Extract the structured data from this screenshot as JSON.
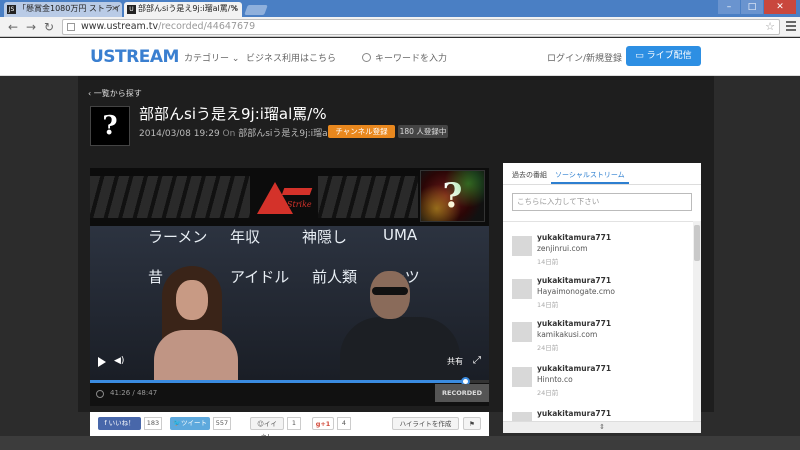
{
  "browser": {
    "tabs": [
      {
        "label": "「懸賞金1080万円 ストライ",
        "favicon": "JS"
      },
      {
        "label": "部部んsiう是え9j:i瑠al罵/%",
        "favicon": "U"
      }
    ],
    "url_host": "www.ustream.tv",
    "url_path": "/recorded/44647679",
    "window_buttons": [
      "–",
      "□",
      "✕"
    ]
  },
  "header": {
    "logo": "USTREAM",
    "nav": [
      "カテゴリー ⌄",
      "ビジネス利用はこちら"
    ],
    "search_placeholder": "キーワードを入力",
    "login": "ログイン/新規登録",
    "live_button": "ライブ配信"
  },
  "channel": {
    "back_link": "‹ 一覧から探す",
    "avatar_glyph": "?",
    "title": "部部んsiう是え9j:i瑠al罵/%",
    "date": "2014/03/08 19:29",
    "on": "On",
    "channel_name": "部部んsiう是え9j:i瑠al罵/%",
    "subscribe": "チャンネル登録",
    "subscriber_count": "180 人登録中"
  },
  "player": {
    "banner_logo_text": "Strike",
    "banner_thumb_glyph": "?",
    "video_words": [
      {
        "text": "ラーメン"
      },
      {
        "text": "年収"
      },
      {
        "text": "神隠し"
      },
      {
        "text": "UMA"
      },
      {
        "text": "昔"
      },
      {
        "text": "アイドル"
      },
      {
        "text": "前人類"
      },
      {
        "text": "ーツ"
      }
    ],
    "progress": 0.94,
    "share": "共有",
    "fullscreen_glyph": "⤢",
    "volume_glyph": "◀)",
    "time": "41:26 / 48:47",
    "badge": "RECORDED LIVE"
  },
  "panel": {
    "tabs": [
      "過去の番組",
      "ソーシャルストリーム"
    ],
    "active_tab": 1,
    "search_placeholder": "こちらに入力して下さい",
    "feed": [
      {
        "user": "yukakitamura771",
        "site": "zenjinrui.com",
        "time": "14日前"
      },
      {
        "user": "yukakitamura771",
        "site": "Hayaimonogate.cmo",
        "time": "14日前"
      },
      {
        "user": "yukakitamura771",
        "site": "kamikakusi.com",
        "time": "24日前"
      },
      {
        "user": "yukakitamura771",
        "site": "Hinnto.co",
        "time": "24日前"
      },
      {
        "user": "yukakitamura771",
        "site": "",
        "time": ""
      }
    ],
    "footer_glyph": "⇕"
  },
  "social": {
    "facebook": "f いいね！",
    "facebook_count": "183",
    "tweet": "ツイート",
    "tweet_count": "557",
    "iine": "イイネ！",
    "iine_count": "1",
    "gplus": "g+1",
    "gplus_count": "4",
    "highlight": "ハイライトを作成",
    "flag": "⚑"
  }
}
